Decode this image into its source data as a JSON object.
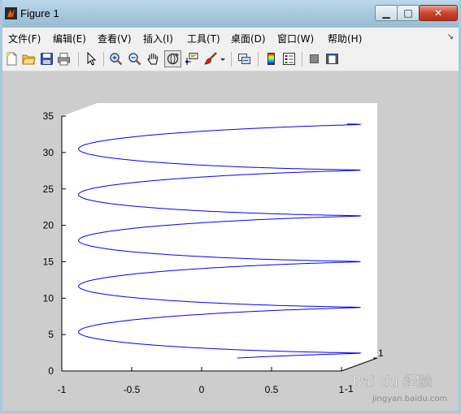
{
  "window": {
    "title": "Figure 1",
    "min_glyph": "▁",
    "max_glyph": "□",
    "close_glyph": "✕"
  },
  "menu": {
    "items": [
      "文件(F)",
      "编辑(E)",
      "查看(V)",
      "插入(I)",
      "工具(T)",
      "桌面(D)",
      "窗口(W)",
      "帮助(H)"
    ],
    "overflow_glyph": "↘"
  },
  "toolbar": {
    "icons": [
      "new-figure-icon",
      "open-file-icon",
      "save-icon",
      "print-icon",
      "select-arrow-icon",
      "zoom-in-icon",
      "zoom-out-icon",
      "pan-hand-icon",
      "rotate-3d-icon",
      "data-cursor-icon",
      "brush-icon",
      "brush-menu-icon",
      "link-plot-icon",
      "colorbar-icon",
      "legend-icon",
      "hide-plot-tools-icon",
      "show-plot-tools-icon"
    ],
    "active_tool": "rotate-3d-icon"
  },
  "chart_data": {
    "type": "line",
    "projection": "3d",
    "description_visible": "helix curve plotted in 3-D axes",
    "z_ticks": [
      "0",
      "5",
      "10",
      "15",
      "20",
      "25",
      "30",
      "35"
    ],
    "x_ticks": [
      "-1",
      "-0.5",
      "0",
      "0.5",
      "1"
    ],
    "y_ticks": [
      "-1",
      "1"
    ],
    "zlim": [
      0,
      35
    ],
    "xlim": [
      -1,
      1
    ],
    "ylim": [
      -1,
      1
    ],
    "series": [
      {
        "color": "#0000ff",
        "t_range": [
          0,
          33.3
        ],
        "x": "sin(t)",
        "y": "cos(t)",
        "z": "t"
      }
    ],
    "grid": false
  },
  "watermark": {
    "line1": "Bai du 经验",
    "line2": "jingyan.baidu.com"
  }
}
